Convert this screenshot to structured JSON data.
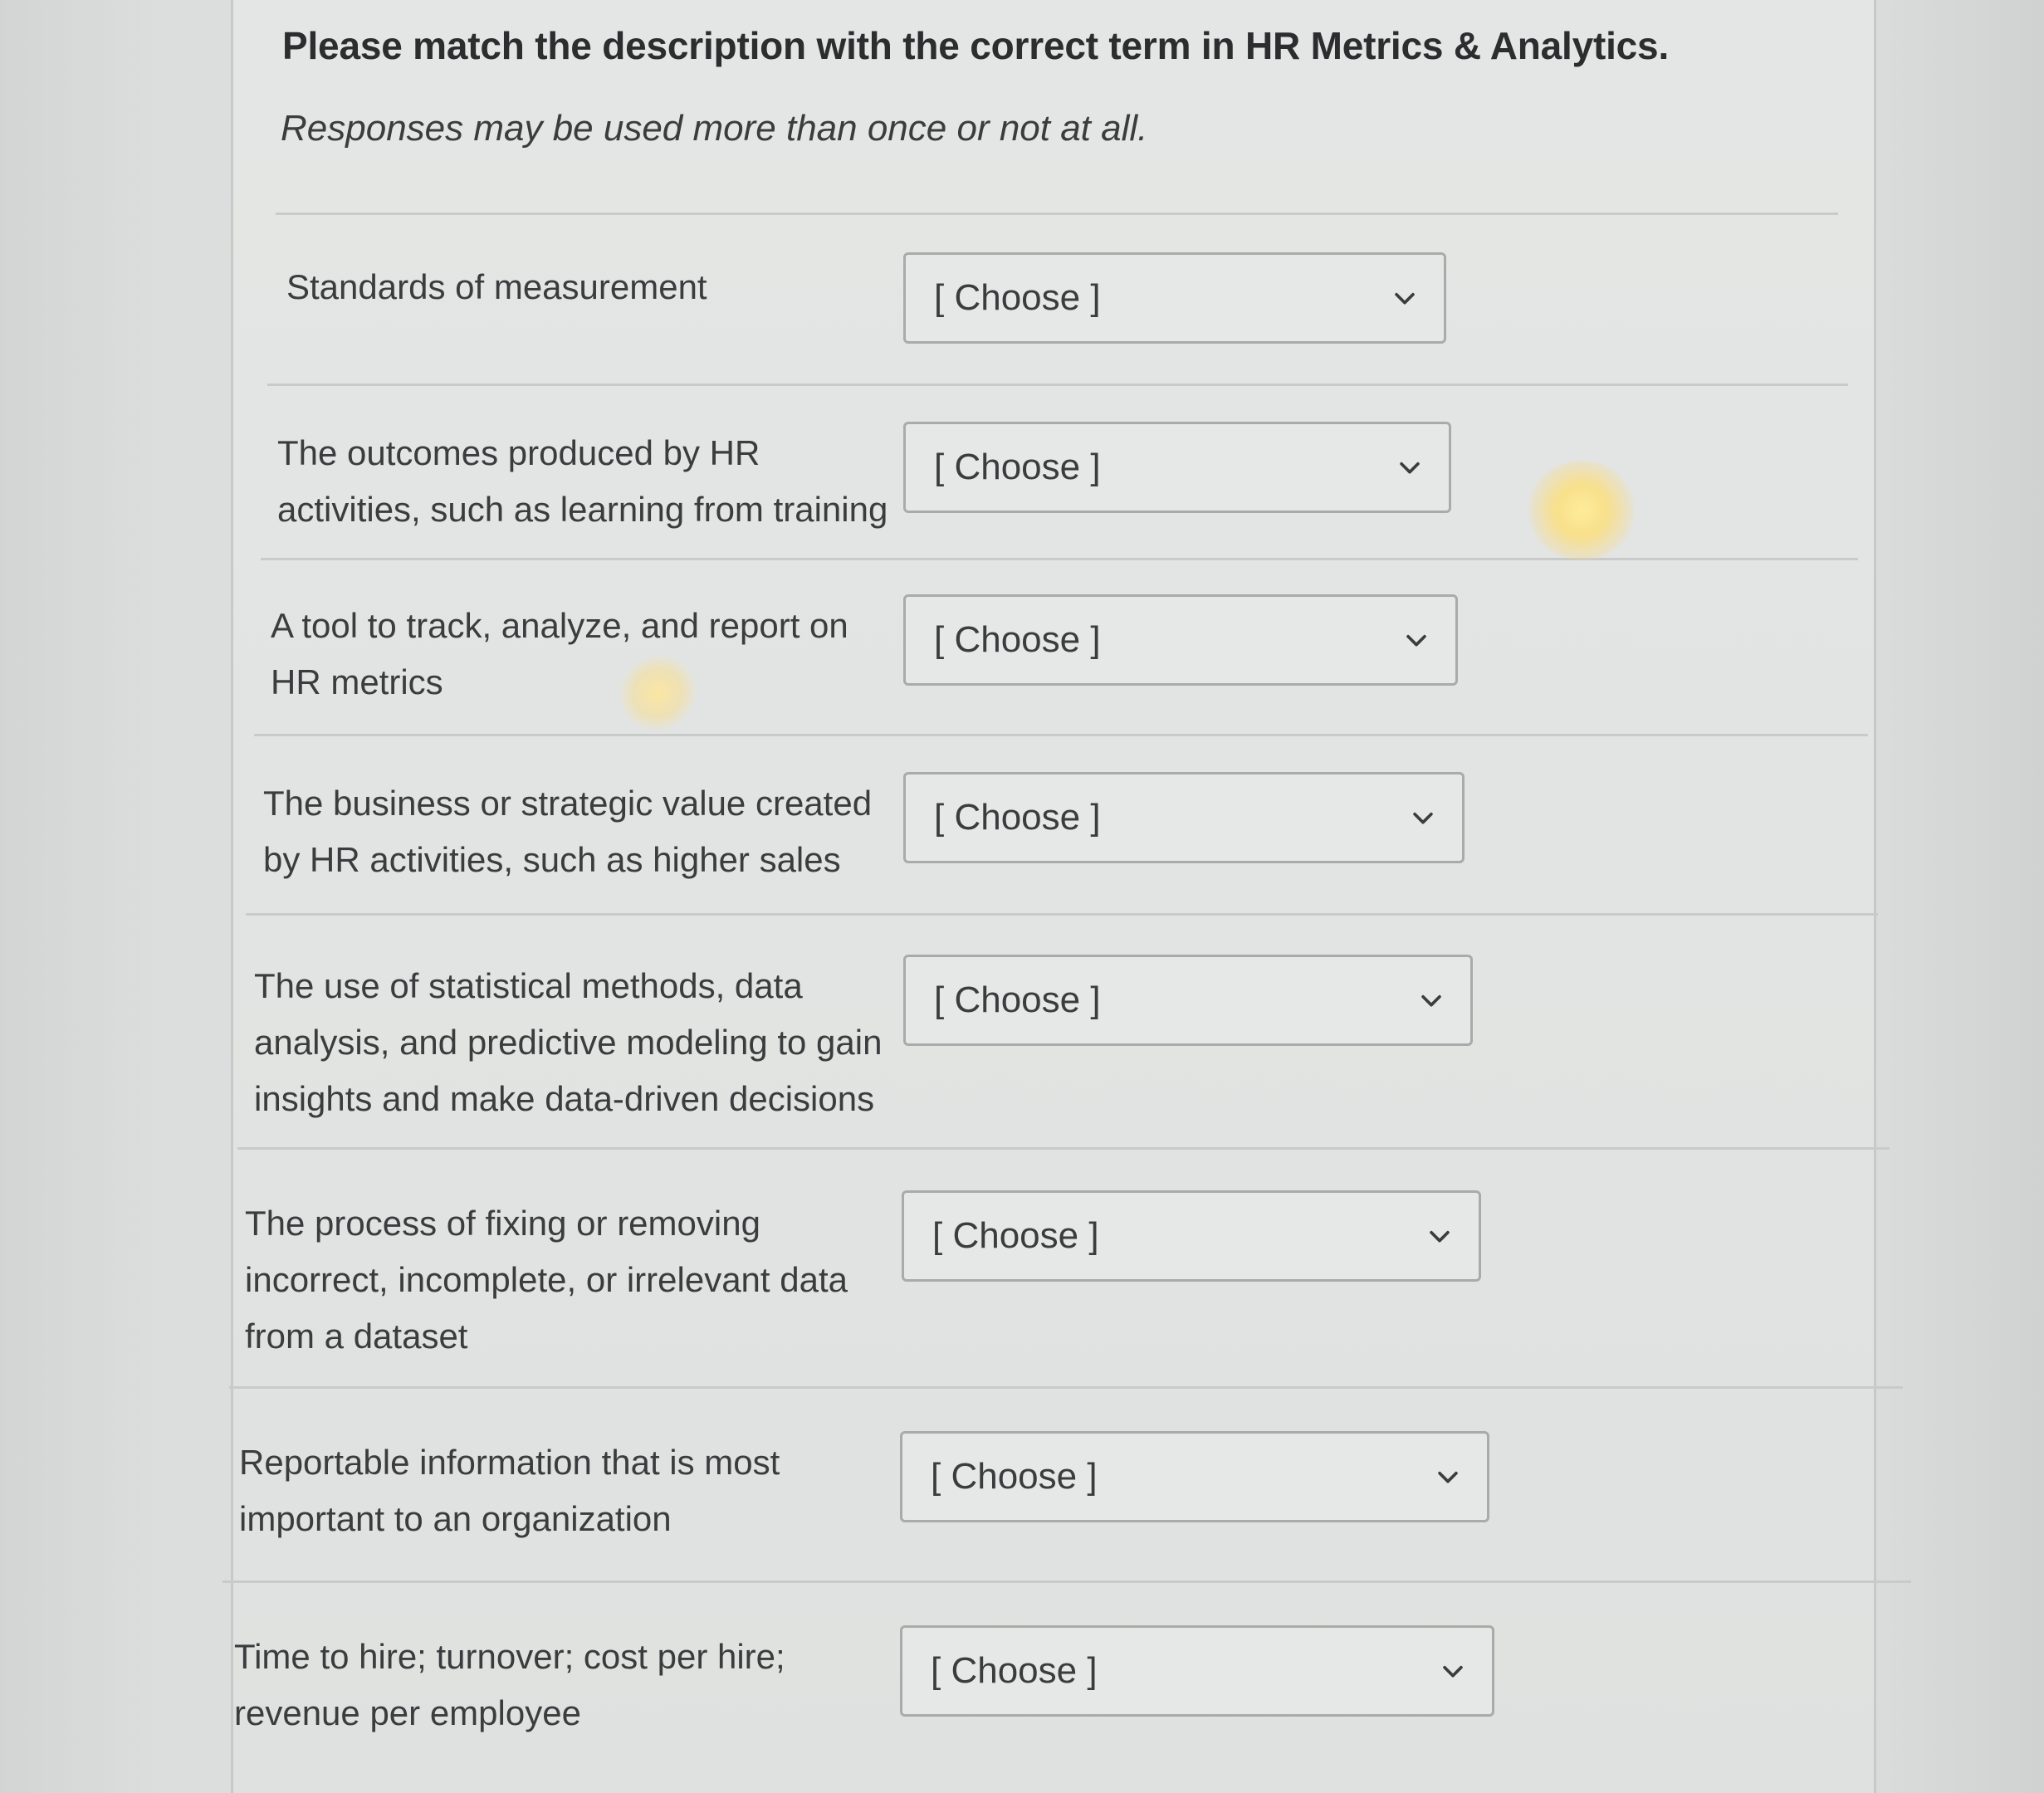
{
  "question": {
    "title": "Please match the description with the correct term in HR Metrics & Analytics.",
    "note": "Responses may be used more than once or not at all."
  },
  "rows": [
    {
      "label": "Standards of measurement",
      "selected": "[ Choose ]"
    },
    {
      "label": "The outcomes produced by HR activities, such as learning from training",
      "selected": "[ Choose ]"
    },
    {
      "label": "A tool to track, analyze, and report on HR metrics",
      "selected": "[ Choose ]"
    },
    {
      "label": "The business or strategic value created by HR activities, such as higher sales",
      "selected": "[ Choose ]"
    },
    {
      "label": "The use of statistical methods, data analysis, and predictive modeling to gain insights and make data-driven decisions",
      "selected": "[ Choose ]"
    },
    {
      "label": "The process of fixing or removing incorrect, incomplete, or irrelevant data from a dataset",
      "selected": "[ Choose ]"
    },
    {
      "label": "Reportable information that is most important to an organization",
      "selected": "[ Choose ]"
    },
    {
      "label": "Time to hire; turnover; cost per hire; revenue per employee",
      "selected": "[ Choose ]"
    }
  ],
  "icons": {
    "dropdown": "chevron-down-icon"
  }
}
